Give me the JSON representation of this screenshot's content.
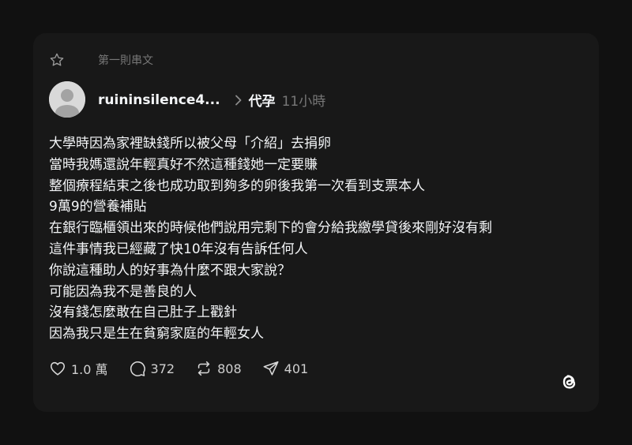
{
  "header": {
    "star_icon": "star-outline-icon",
    "label": "第一則串文"
  },
  "author": {
    "avatar_icon": "default-avatar-icon",
    "username": "ruininsilence4...",
    "topic": "代孕",
    "time": "11小時"
  },
  "post": {
    "lines": [
      "大學時因為家裡缺錢所以被父母「介紹」去捐卵",
      "當時我媽還說年輕真好不然這種錢她一定要賺",
      "整個療程結束之後也成功取到夠多的卵後我第一次看到支票本人",
      "9萬9的營養補貼",
      "在銀行臨櫃領出來的時候他們說用完剩下的會分給我繳學貸後來剛好沒有剩",
      "這件事情我已經藏了快10年沒有告訴任何人",
      "你說這種助人的好事為什麼不跟大家說？",
      "可能因為我不是善良的人",
      "沒有錢怎麼敢在自己肚子上戳針",
      "因為我只是生在貧窮家庭的年輕女人"
    ]
  },
  "actions": {
    "likes": "1.0 萬",
    "comments": "372",
    "reposts": "808",
    "shares": "401"
  },
  "brand": {
    "logo": "threads-logo-icon"
  },
  "colors": {
    "background": "#111111",
    "card": "#181818",
    "text": "#f3f5f7",
    "muted": "#777777"
  }
}
